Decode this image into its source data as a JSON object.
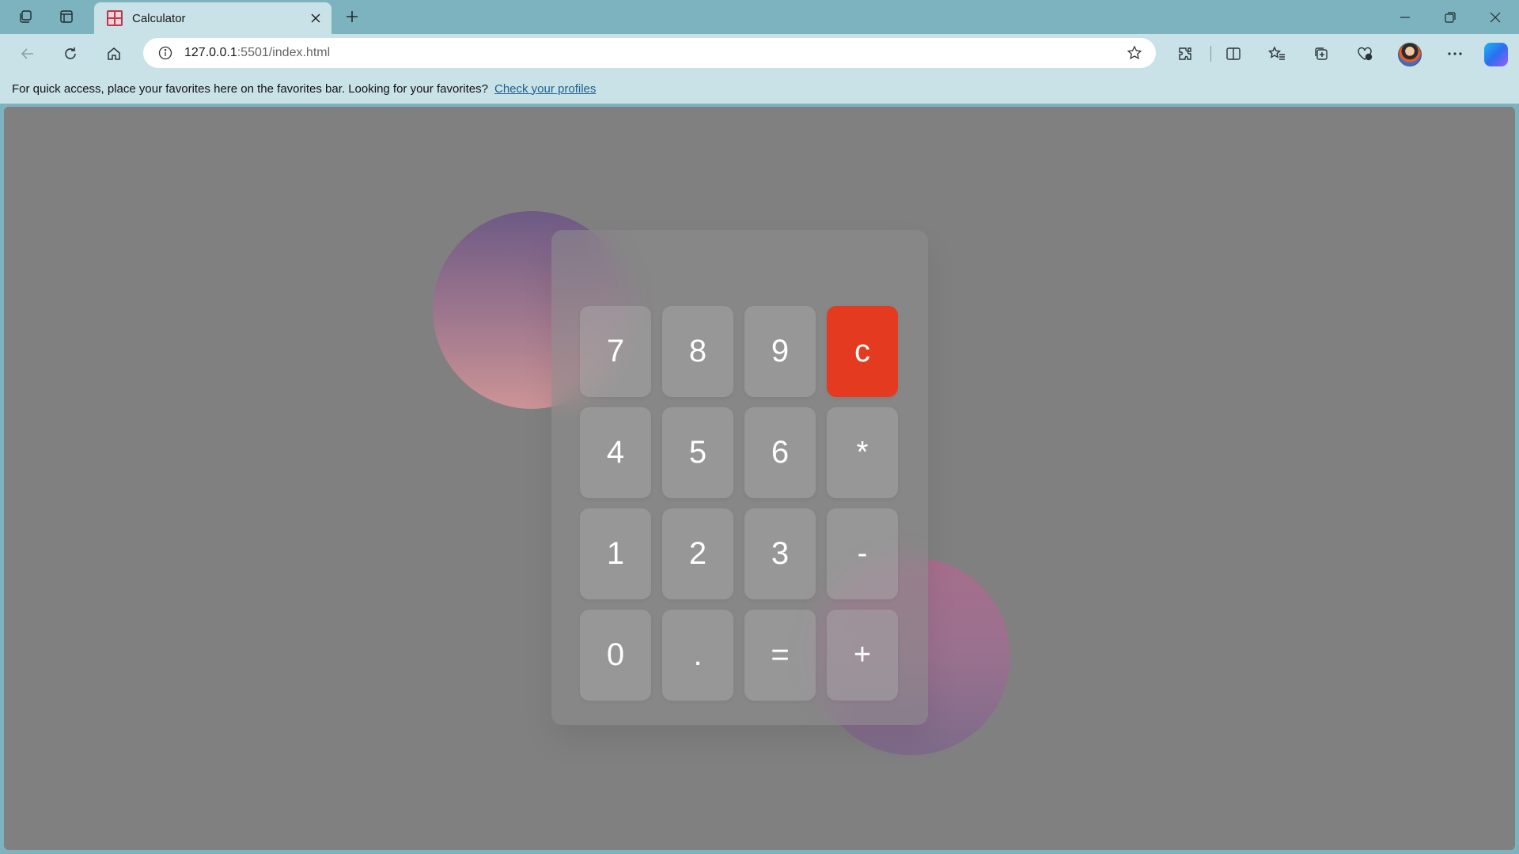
{
  "browser": {
    "tab": {
      "title": "Calculator"
    },
    "address": {
      "host": "127.0.0.1",
      "path": ":5501/index.html"
    },
    "favorites_bar": {
      "message": "For quick access, place your favorites here on the favorites bar. Looking for your favorites?",
      "link": "Check your profiles"
    }
  },
  "calculator": {
    "keys": [
      {
        "label": "7",
        "role": "digit"
      },
      {
        "label": "8",
        "role": "digit"
      },
      {
        "label": "9",
        "role": "digit"
      },
      {
        "label": "c",
        "role": "clear",
        "color": "#e43a20"
      },
      {
        "label": "4",
        "role": "digit"
      },
      {
        "label": "5",
        "role": "digit"
      },
      {
        "label": "6",
        "role": "digit"
      },
      {
        "label": "*",
        "role": "operator"
      },
      {
        "label": "1",
        "role": "digit"
      },
      {
        "label": "2",
        "role": "digit"
      },
      {
        "label": "3",
        "role": "digit"
      },
      {
        "label": "-",
        "role": "operator"
      },
      {
        "label": "0",
        "role": "digit"
      },
      {
        "label": ".",
        "role": "decimal"
      },
      {
        "label": "=",
        "role": "equals"
      },
      {
        "label": "+",
        "role": "operator"
      }
    ]
  },
  "colors": {
    "page_background": "#808080",
    "clear_button": "#e43a20",
    "browser_frame": "#7db3bf",
    "toolbar": "#c9e2e7"
  }
}
